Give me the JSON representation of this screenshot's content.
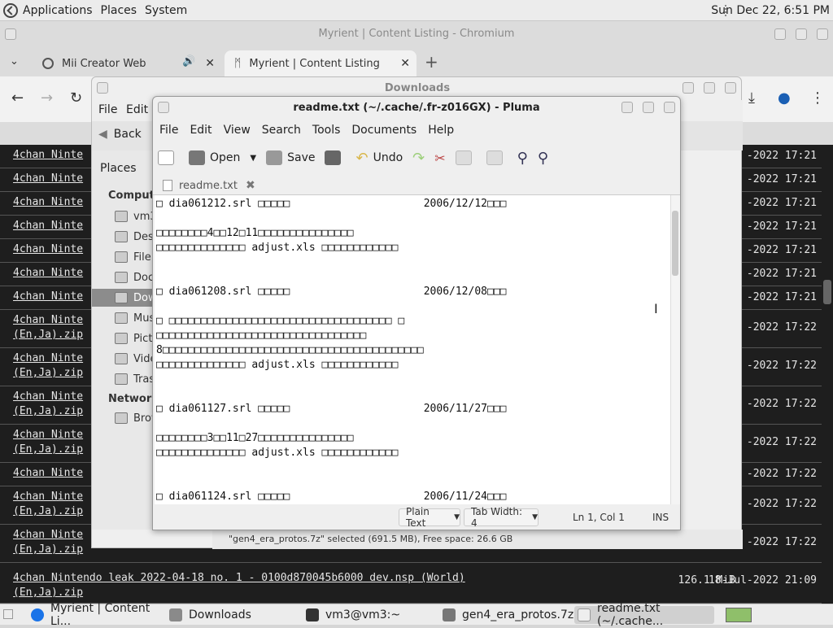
{
  "top_panel": {
    "menus": [
      "Applications",
      "Places",
      "System"
    ],
    "clock": "Sun Dec 22, 6:51 PM"
  },
  "chromium": {
    "window_title": "Myrient | Content Listing - Chromium",
    "tabs": [
      {
        "label": "Mii Creator Web"
      },
      {
        "label": "Myrient | Content Listing"
      }
    ],
    "new_tab": "+",
    "page_rows": [
      {
        "name": "4chan Ninte",
        "date": "-2022 17:21"
      },
      {
        "name": "4chan Ninte",
        "date": "-2022 17:21"
      },
      {
        "name": "4chan Ninte",
        "date": "-2022 17:21"
      },
      {
        "name": "4chan Ninte",
        "date": "-2022 17:21"
      },
      {
        "name": "4chan Ninte",
        "date": "-2022 17:21"
      },
      {
        "name": "4chan Ninte",
        "date": "-2022 17:21"
      },
      {
        "name": "4chan Ninte",
        "date": "-2022 17:21"
      },
      {
        "name": "4chan Ninte\n(En,Ja).zip",
        "date": "-2022 17:22"
      },
      {
        "name": "4chan Ninte\n(En,Ja).zip",
        "date": "-2022 17:22"
      },
      {
        "name": "4chan Ninte\n(En,Ja).zip",
        "date": "-2022 17:22"
      },
      {
        "name": "4chan Ninte\n(En,Ja).zip",
        "date": "-2022 17:22"
      },
      {
        "name": "4chan Ninte",
        "date": "-2022 17:22"
      },
      {
        "name": "4chan Ninte\n(En,Ja).zip",
        "date": "-2022 17:22"
      },
      {
        "name": "4chan Ninte\n(En,Ja).zip",
        "date": "-2022 17:22"
      }
    ],
    "last_row": {
      "name": "4chan Nintendo leak 2022-04-18 no. 1 - 0100d870045b6000 dev.nsp (World)\n(En,Ja).zip",
      "size": "126.1 MiB",
      "date": "18-Jul-2022 21:09"
    }
  },
  "downloads": {
    "title": "Downloads",
    "menus": [
      "File",
      "Edit"
    ],
    "back_label": "Back",
    "places_label": "Places",
    "computer_heading": "Computer",
    "places": [
      "vm3",
      "Desktop",
      "File System",
      "Documents",
      "Downloads",
      "Music",
      "Pictures",
      "Videos",
      "Trash"
    ],
    "network_heading": "Network",
    "network_items": [
      "Browse Network"
    ],
    "status": "\"gen4_era_protos.7z\" selected (691.5 MB), Free space: 26.6 GB"
  },
  "pluma": {
    "title": "readme.txt (~/.cache/.fr-z016GX) - Pluma",
    "menus": [
      "File",
      "Edit",
      "View",
      "Search",
      "Tools",
      "Documents",
      "Help"
    ],
    "toolbar": {
      "open": "Open",
      "save": "Save",
      "undo": "Undo"
    },
    "doc_tab": "readme.txt",
    "lines": [
      "□ dia061212.srl □□□□□                     2006/12/12□□□",
      "",
      "□□□□□□□□4□□12□11□□□□□□□□□□□□□□□",
      "□□□□□□□□□□□□□□ adjust.xls □□□□□□□□□□□□",
      "",
      "",
      "□ dia061208.srl □□□□□                     2006/12/08□□□",
      "",
      "□ □□□□□□□□□□□□□□□□□□□□□□□□□□□□□□□□□□□ □",
      "□□□□□□□□□□□□□□□□□□□□□□□□□□□□□□□□□",
      "8□□□□□□□□□□□□□□□□□□□□□□□□□□□□□□□□□□□□□□□□□",
      "□□□□□□□□□□□□□□ adjust.xls □□□□□□□□□□□□",
      "",
      "",
      "□ dia061127.srl □□□□□                     2006/11/27□□□",
      "",
      "□□□□□□□□3□□11□27□□□□□□□□□□□□□□□",
      "□□□□□□□□□□□□□□ adjust.xls □□□□□□□□□□□□",
      "",
      "",
      "□ dia061124.srl □□□□□                     2006/11/24□□□"
    ],
    "status": {
      "syntax": "Plain Text",
      "tab_width": "Tab Width:  4",
      "position": "Ln 1, Col 1",
      "mode": "INS"
    }
  },
  "taskbar": {
    "items": [
      "Myrient | Content Li...",
      "Downloads",
      "vm3@vm3:~",
      "gen4_era_protos.7z",
      "readme.txt (~/.cache..."
    ]
  }
}
